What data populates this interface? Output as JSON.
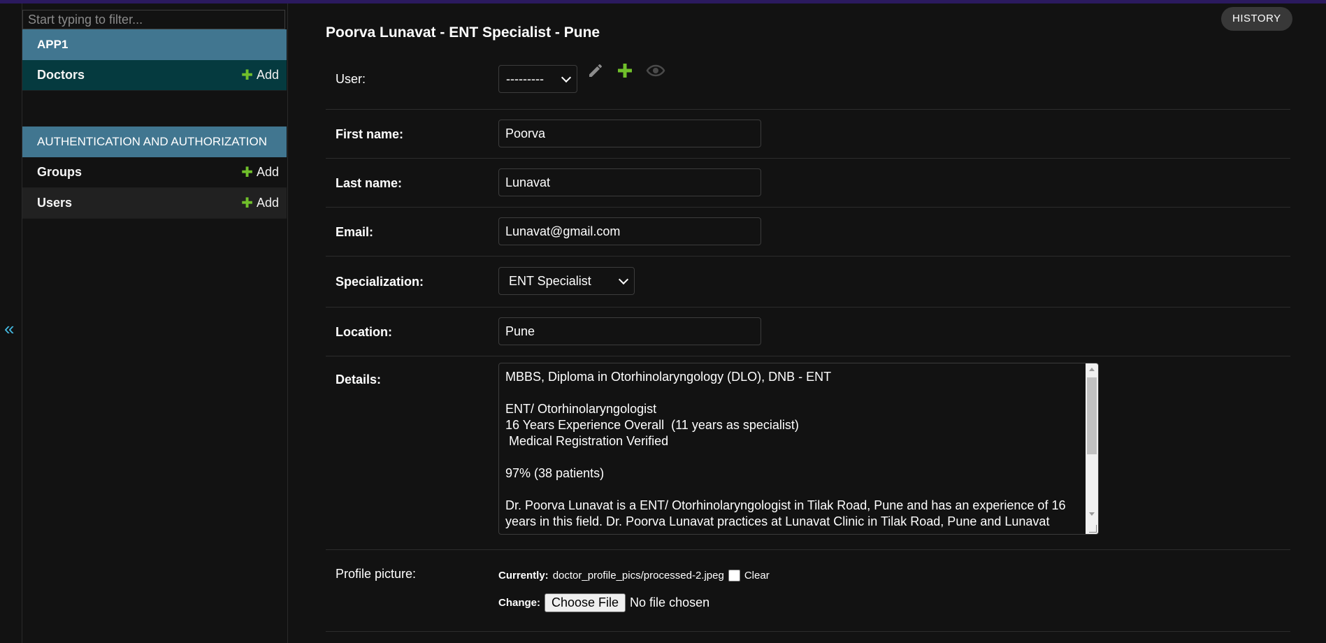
{
  "sidebar": {
    "filter_placeholder": "Start typing to filter...",
    "collapse_label": "«",
    "modules": [
      {
        "title": "APP1",
        "items": [
          {
            "label": "Doctors",
            "add_label": "Add"
          }
        ]
      },
      {
        "title": "AUTHENTICATION AND AUTHORIZATION",
        "items": [
          {
            "label": "Groups",
            "add_label": "Add"
          },
          {
            "label": "Users",
            "add_label": "Add"
          }
        ]
      }
    ],
    "add_icon": "plus-icon"
  },
  "header": {
    "title": "Poorva Lunavat - ENT Specialist - Pune",
    "history_label": "HISTORY"
  },
  "form": {
    "user": {
      "label": "User:",
      "value": "---------",
      "icons": [
        "pencil-icon",
        "plus-icon",
        "eye-icon"
      ]
    },
    "first_name": {
      "label": "First name:",
      "value": "Poorva"
    },
    "last_name": {
      "label": "Last name:",
      "value": "Lunavat"
    },
    "email": {
      "label": "Email:",
      "value": "Lunavat@gmail.com"
    },
    "specialization": {
      "label": "Specialization:",
      "value": "ENT Specialist"
    },
    "location": {
      "label": "Location:",
      "value": "Pune"
    },
    "details": {
      "label": "Details:",
      "value": "MBBS, Diploma in Otorhinolaryngology (DLO), DNB - ENT\n\nENT/ Otorhinolaryngologist\n16 Years Experience Overall  (11 years as specialist)\n Medical Registration Verified\n\n97% (38 patients)\n\nDr. Poorva Lunavat is a ENT/ Otorhinolaryngologist in Tilak Road, Pune and has an experience of 16 years in this field. Dr. Poorva Lunavat practices at Lunavat Clinic in Tilak Road, Pune and Lunavat"
    },
    "profile_picture": {
      "label": "Profile picture:",
      "currently_label": "Currently:",
      "current_file": "doctor_profile_pics/processed-2.jpeg",
      "clear_label": "Clear",
      "change_label": "Change:",
      "choose_label": "Choose File",
      "no_file_label": "No file chosen"
    }
  },
  "colors": {
    "accent": "#417690",
    "current_row": "#053a3f",
    "add_plus": "#70bf2b",
    "toggle": "#44b8e0",
    "top_bar": "#2b1a5e"
  }
}
